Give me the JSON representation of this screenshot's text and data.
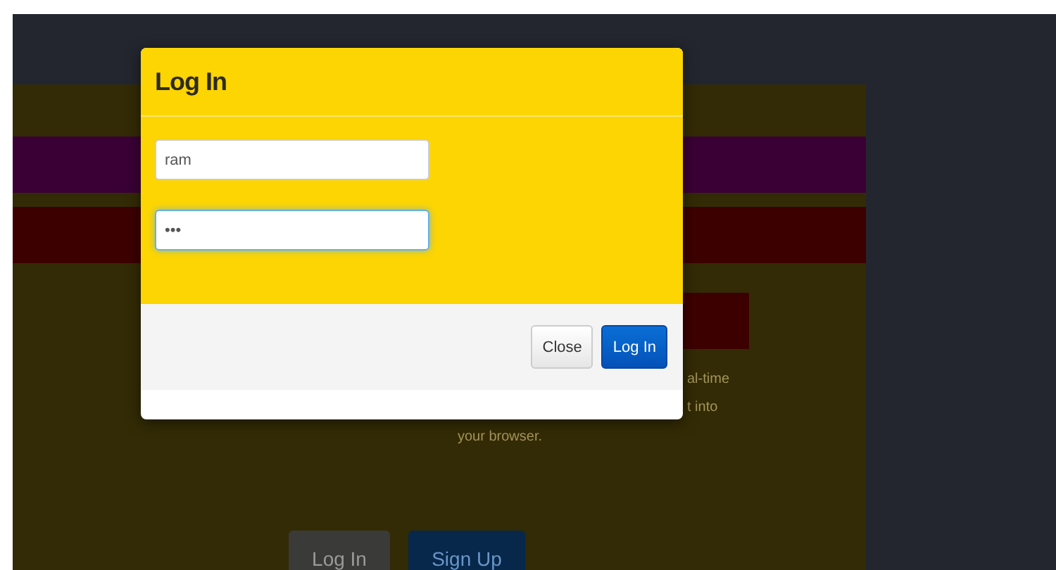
{
  "background_page": {
    "text_fragments": [
      "al-time",
      "t into",
      "your browser."
    ],
    "buttons": [
      {
        "label": "Log In",
        "kind": "secondary"
      },
      {
        "label": "Sign Up",
        "kind": "primary"
      }
    ]
  },
  "modal": {
    "title": "Log In",
    "fields": [
      {
        "value": "ram",
        "focused": false
      },
      {
        "value": "•••",
        "focused": true
      }
    ],
    "buttons": [
      {
        "label": "Close",
        "kind": "secondary"
      },
      {
        "label": "Log In",
        "kind": "primary"
      }
    ]
  }
}
